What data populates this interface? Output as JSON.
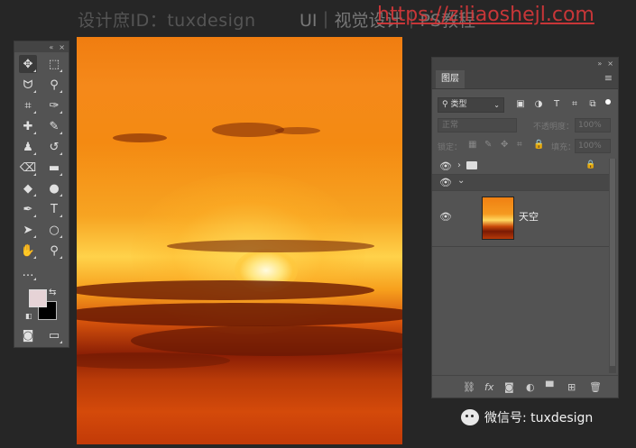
{
  "watermark": {
    "left": "设计庶ID：tuxdesign",
    "mid": "UI｜视觉设计｜PS教程",
    "url": "https://ziliaoshejl.com"
  },
  "toolbar": {
    "header_collapse": "«",
    "header_close": "×",
    "tools": [
      {
        "name": "move-tool",
        "glyph": "✥"
      },
      {
        "name": "marquee-tool",
        "glyph": "⬚"
      },
      {
        "name": "lasso-tool",
        "glyph": "ᗢ"
      },
      {
        "name": "magic-wand-tool",
        "glyph": "⚲"
      },
      {
        "name": "crop-tool",
        "glyph": "⌗"
      },
      {
        "name": "eyedropper-tool",
        "glyph": "✑"
      },
      {
        "name": "healing-brush-tool",
        "glyph": "✚"
      },
      {
        "name": "brush-tool",
        "glyph": "✎"
      },
      {
        "name": "clone-stamp-tool",
        "glyph": "♟"
      },
      {
        "name": "history-brush-tool",
        "glyph": "↺"
      },
      {
        "name": "eraser-tool",
        "glyph": "⌫"
      },
      {
        "name": "gradient-tool",
        "glyph": "▬"
      },
      {
        "name": "blur-tool",
        "glyph": "◆"
      },
      {
        "name": "dodge-tool",
        "glyph": "●"
      },
      {
        "name": "pen-tool",
        "glyph": "✒"
      },
      {
        "name": "type-tool",
        "glyph": "T"
      },
      {
        "name": "path-selection-tool",
        "glyph": "➤"
      },
      {
        "name": "ellipse-tool",
        "glyph": "○"
      },
      {
        "name": "hand-tool",
        "glyph": "✋"
      },
      {
        "name": "zoom-tool",
        "glyph": "⚲"
      },
      {
        "name": "more-tools",
        "glyph": "…"
      }
    ],
    "swap_glyph": "⇆",
    "default_glyph": "◧",
    "quick_mask_glyph": "◙",
    "screen_mode_glyph": "▭",
    "foreground_color": "#e6d3d6",
    "background_color": "#000000"
  },
  "layers_panel": {
    "header_collapse": "»",
    "header_close": "×",
    "tab_label": "图层",
    "menu_glyph": "≡",
    "filter": {
      "kind_label": "⚲ 类型",
      "caret": "⌄",
      "icons": [
        "▣",
        "◑",
        "T",
        "⌗",
        "⧉"
      ]
    },
    "blend_mode": "正常",
    "opacity_label": "不透明度：",
    "opacity_value": "100%",
    "lock_label": "锁定：",
    "lock_icons": [
      "▦",
      "✎",
      "✥",
      "⌗",
      "🔒"
    ],
    "fill_label": "填充：",
    "fill_value": "100%",
    "group_lock": "🔒",
    "group_chevron": "›",
    "sub_chevron": "⌄",
    "layer_name": "天空",
    "bottom_icons": [
      "⛓",
      "fx",
      "◙",
      "◐",
      "▀",
      "⊞",
      "🗑"
    ]
  },
  "wechat": {
    "text": "微信号: tuxdesign"
  }
}
